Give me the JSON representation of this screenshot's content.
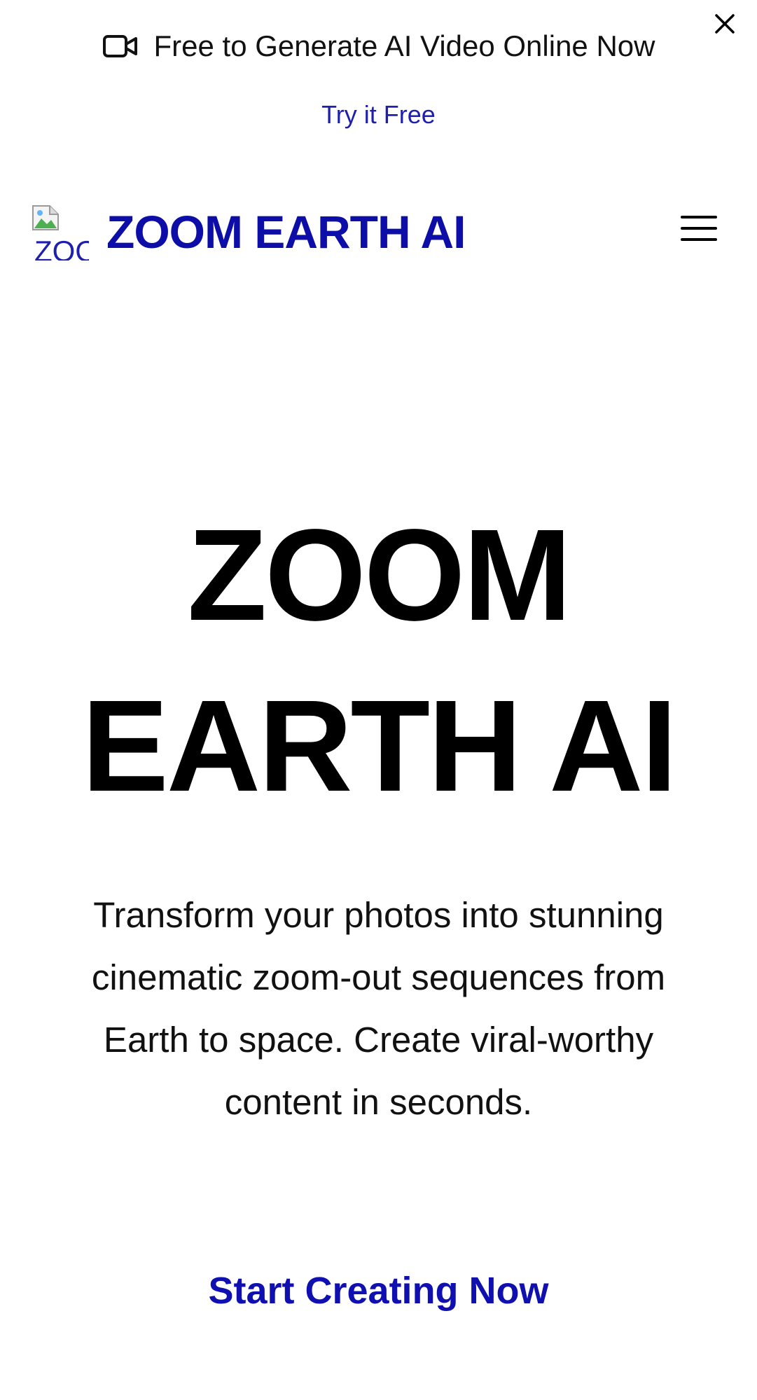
{
  "banner": {
    "icon": "video-camera-icon",
    "title": "Free to Generate AI Video Online Now",
    "link_label": "Try it Free",
    "close_icon": "close-icon"
  },
  "navbar": {
    "logo_alt": "ZOOM",
    "brand_label": "ZOOM EARTH AI",
    "menu_icon": "hamburger-menu-icon"
  },
  "hero": {
    "title_line1": "ZOOM",
    "title_line2": "EARTH AI",
    "subtitle": "Transform your photos into stunning cinematic zoom-out sequences from Earth to space. Create viral-worthy content in seconds.",
    "cta_label": "Start Creating Now"
  },
  "colors": {
    "link_blue": "#1f1fae",
    "brand_blue": "#0d0da8",
    "text": "#000000",
    "background": "#ffffff"
  }
}
